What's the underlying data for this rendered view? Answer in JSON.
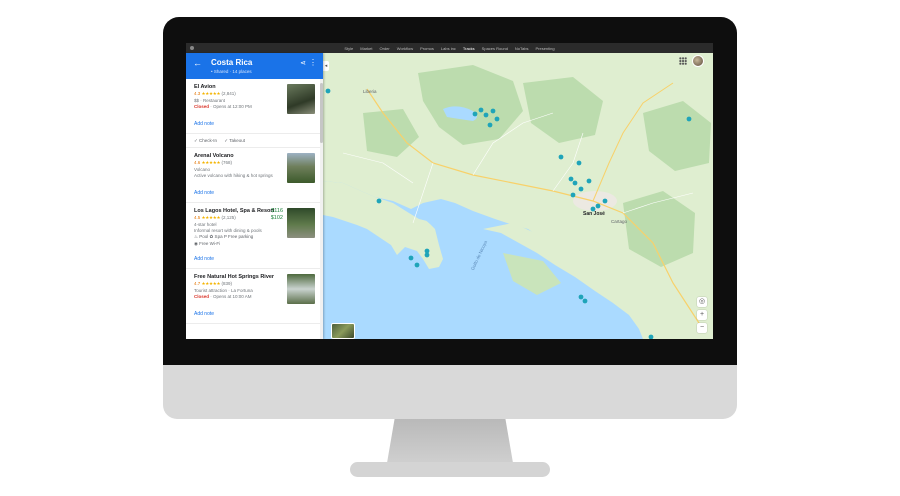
{
  "menubar": {
    "items": [
      "Style",
      "Market",
      "Order",
      "Workflow",
      "Promos",
      "Labs inc",
      "Tracks",
      "Spaces Round",
      "NoTabs",
      "Presenting"
    ],
    "active_index": 6
  },
  "panel": {
    "back_icon": "arrow-left-icon",
    "title": "Costa Rica",
    "subtitle": "• Shared · 14 places",
    "share_icon": "share-icon",
    "more_icon": "more-vert-icon",
    "accent": "#1a73e8"
  },
  "places": [
    {
      "name": "El Avion",
      "rating": "4.3",
      "stars": "★★★★★",
      "reviews": "(2,841)",
      "line1": "$$ · Restaurant",
      "closed": "Closed",
      "line2": " · Opens at 12:00 PM",
      "note": "Add note"
    },
    {
      "name": "Arenal Volcano",
      "rating": "4.6",
      "stars": "★★★★★",
      "reviews": "(768)",
      "line1": "Volcano",
      "line2": "Active volcano with hiking & hot springs",
      "note": "Add note"
    },
    {
      "name": "Los Lagos Hotel, Spa & Resort",
      "rating": "4.5",
      "stars": "★★★★★",
      "reviews": "(2,125)",
      "line1": "4-star hotel",
      "line2": "Informal resort with dining & pools",
      "price1": "$116",
      "price2": "$102",
      "amenities": "♨ Pool   ✿ Spa   P Free parking",
      "amenities2": "◉ Free Wi-Fi",
      "note": "Add note"
    },
    {
      "name": "Free Natural Hot Springs River",
      "rating": "4.7",
      "stars": "★★★★★",
      "reviews": "(839)",
      "line1": "Tourist attraction · La Fortuna",
      "closed": "Closed",
      "line2": " · Opens at 10:00 AM",
      "note": "Add note"
    }
  ],
  "checks": {
    "a": "✓ Check-In",
    "b": "✓ Takeout"
  },
  "map": {
    "labels": {
      "liberia": "Liberia",
      "san_jose": "San José",
      "cartago": "Cartago",
      "gulf": "Golfo de Nicoya"
    },
    "apps_icon": "apps-grid-icon",
    "zoom_in": "+",
    "zoom_out": "−",
    "locate_icon": "my-location-icon",
    "collapse": "◂",
    "colors": {
      "water": "#aadaff",
      "land": "#dfeed0",
      "forest": "#bcdcae",
      "pin": "#1fa4b9",
      "road": "#f8d16a"
    }
  }
}
